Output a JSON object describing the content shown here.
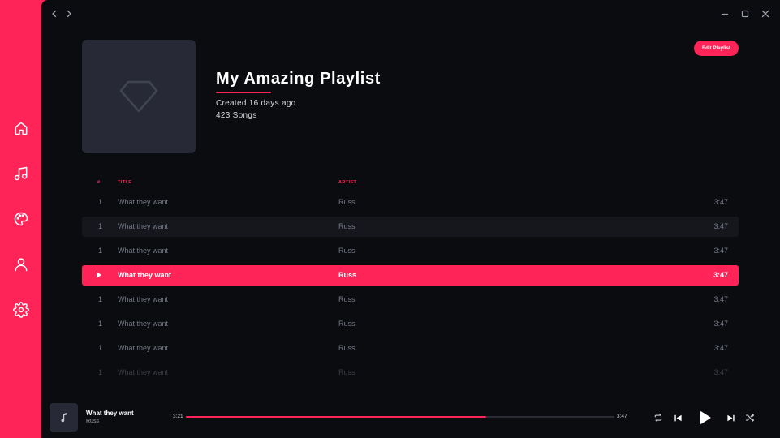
{
  "sidebar": {
    "items": [
      {
        "icon": "home-icon"
      },
      {
        "icon": "music-icon"
      },
      {
        "icon": "palette-icon"
      },
      {
        "icon": "user-icon"
      },
      {
        "icon": "gear-icon"
      }
    ]
  },
  "window": {
    "back_icon": "chevron-left-icon",
    "forward_icon": "chevron-right-icon",
    "minimize_icon": "minimize-icon",
    "maximize_icon": "maximize-icon",
    "close_icon": "close-icon"
  },
  "playlist": {
    "title": "My Amazing Playlist",
    "created": "Created 16 days ago",
    "song_count": "423 Songs",
    "edit_label": "Edit Playlist",
    "cover_icon": "diamond-icon"
  },
  "table": {
    "headers": {
      "num": "#",
      "title": "TITLE",
      "artist": "ARTIST"
    },
    "rows": [
      {
        "num": "1",
        "title": "What they want",
        "artist": "Russ",
        "duration": "3:47",
        "state": "normal"
      },
      {
        "num": "1",
        "title": "What they want",
        "artist": "Russ",
        "duration": "3:47",
        "state": "alt"
      },
      {
        "num": "1",
        "title": "What they want",
        "artist": "Russ",
        "duration": "3:47",
        "state": "normal"
      },
      {
        "num": "",
        "title": "What they want",
        "artist": "Russ",
        "duration": "3:47",
        "state": "playing"
      },
      {
        "num": "1",
        "title": "What they want",
        "artist": "Russ",
        "duration": "3:47",
        "state": "normal"
      },
      {
        "num": "1",
        "title": "What they want",
        "artist": "Russ",
        "duration": "3:47",
        "state": "normal"
      },
      {
        "num": "1",
        "title": "What they want",
        "artist": "Russ",
        "duration": "3:47",
        "state": "normal"
      },
      {
        "num": "1",
        "title": "What they want",
        "artist": "Russ",
        "duration": "3:47",
        "state": "faded"
      }
    ]
  },
  "player": {
    "title": "What they want",
    "artist": "Russ",
    "elapsed": "3:21",
    "total": "3:47",
    "progress": 0.7,
    "icons": [
      "repeat-icon",
      "skip-back-icon",
      "play-icon",
      "skip-forward-icon",
      "shuffle-icon"
    ]
  },
  "colors": {
    "accent": "#ff2458",
    "background": "#0b0c10",
    "row_alt": "#15171d",
    "cover": "#272a36"
  }
}
